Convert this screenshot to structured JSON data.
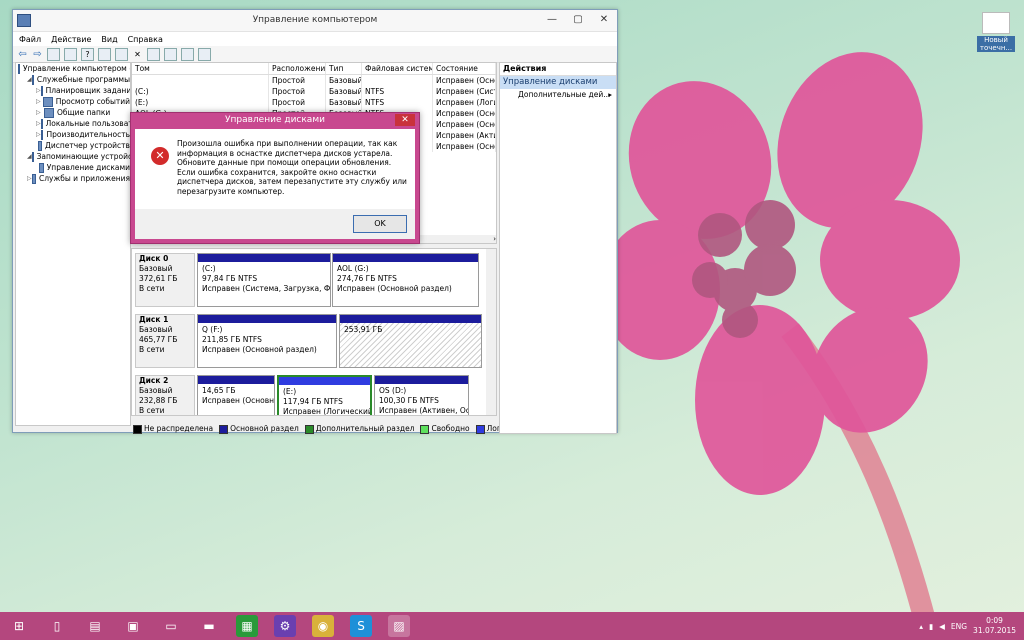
{
  "window": {
    "title": "Управление компьютером",
    "menu": [
      "Файл",
      "Действие",
      "Вид",
      "Справка"
    ],
    "controls": {
      "min": "—",
      "max": "▢",
      "close": "✕"
    }
  },
  "tree": [
    {
      "label": "Управление компьютером (л",
      "indent": 0,
      "toggle": ""
    },
    {
      "label": "Служебные программы",
      "indent": 1,
      "toggle": "◢"
    },
    {
      "label": "Планировщик заданий",
      "indent": 2,
      "toggle": "▷"
    },
    {
      "label": "Просмотр событий",
      "indent": 2,
      "toggle": "▷"
    },
    {
      "label": "Общие папки",
      "indent": 2,
      "toggle": "▷"
    },
    {
      "label": "Локальные пользовате",
      "indent": 2,
      "toggle": "▷"
    },
    {
      "label": "Производительность",
      "indent": 2,
      "toggle": "▷"
    },
    {
      "label": "Диспетчер устройств",
      "indent": 2,
      "toggle": ""
    },
    {
      "label": "Запоминающие устройст",
      "indent": 1,
      "toggle": "◢"
    },
    {
      "label": "Управление дисками",
      "indent": 2,
      "toggle": ""
    },
    {
      "label": "Службы и приложения",
      "indent": 1,
      "toggle": "▷"
    }
  ],
  "volumes": {
    "headers": [
      "Том",
      "Расположение",
      "Тип",
      "Файловая система",
      "Состояние"
    ],
    "rows": [
      [
        "",
        "Простой",
        "Базовый",
        "",
        "Исправен (Основ"
      ],
      [
        "(C:)",
        "Простой",
        "Базовый",
        "NTFS",
        "Исправен (Систе"
      ],
      [
        "(E:)",
        "Простой",
        "Базовый",
        "NTFS",
        "Исправен (Логич"
      ],
      [
        "AOL (G:)",
        "Простой",
        "Базовый",
        "NTFS",
        "Исправен (Основ"
      ],
      [
        "",
        "",
        "",
        "",
        "Исправен (Основ"
      ],
      [
        "",
        "",
        "",
        "",
        "Исправен (Активн"
      ],
      [
        "",
        "",
        "",
        "",
        "Исправен (Основ"
      ]
    ]
  },
  "disks": [
    {
      "name": "Диск 0",
      "type": "Базовый",
      "size": "372,61 ГБ",
      "status": "В сети",
      "parts": [
        {
          "title": "(C:)",
          "size": "97,84 ГБ NTFS",
          "state": "Исправен (Система, Загрузка, Файл г"
        },
        {
          "title": "AOL  (G:)",
          "size": "274,76 ГБ NTFS",
          "state": "Исправен (Основной раздел)"
        }
      ]
    },
    {
      "name": "Диск 1",
      "type": "Базовый",
      "size": "465,77 ГБ",
      "status": "В сети",
      "parts": [
        {
          "title": "Q  (F:)",
          "size": "211,85 ГБ NTFS",
          "state": "Исправен (Основной раздел)"
        },
        {
          "title": "",
          "size": "253,91 ГБ",
          "state": ""
        }
      ]
    },
    {
      "name": "Диск 2",
      "type": "Базовый",
      "size": "232,88 ГБ",
      "status": "В сети",
      "parts": [
        {
          "title": "",
          "size": "14,65 ГБ",
          "state": "Исправен (Основной"
        },
        {
          "title": "(E:)",
          "size": "117,94 ГБ NTFS",
          "state": "Исправен (Логический д"
        },
        {
          "title": "OS  (D:)",
          "size": "100,30 ГБ NTFS",
          "state": "Исправен (Активен, Осно"
        }
      ]
    }
  ],
  "legend": [
    {
      "label": "Не распределена",
      "color": "#000000"
    },
    {
      "label": "Основной раздел",
      "color": "#1c1c9c"
    },
    {
      "label": "Дополнительный раздел",
      "color": "#2a8a2a"
    },
    {
      "label": "Свободно",
      "color": "#5ee05e"
    },
    {
      "label": "Логический диск",
      "color": "#2f3ce0"
    }
  ],
  "actions": {
    "header": "Действия",
    "selected": "Управление дисками",
    "more": "Дополнительные дей..."
  },
  "dialog": {
    "title": "Управление дисками",
    "message": "Произошла ошибка при выполнении операции, так как информация в оснастке диспетчера дисков устарела. Обновите данные при помощи операции обновления.  Если ошибка сохранится, закройте окно оснастки диспетчера дисков, затем перезапустите эту службу или перезагрузите компьютер.",
    "ok": "OK",
    "close": "✕"
  },
  "desktop_icon": {
    "label": "Новый точечн..."
  },
  "taskbar": {
    "icons": [
      "windows-start-icon",
      "file-explorer-icon",
      "notepad-icon",
      "remote-desktop-icon",
      "computer-icon",
      "folder-icon",
      "store-icon",
      "settings-icon",
      "chrome-icon",
      "skype-icon",
      "computer-management-icon"
    ],
    "tray": {
      "lang": "ENG",
      "time": "0:09",
      "date": "31.07.2015"
    }
  }
}
